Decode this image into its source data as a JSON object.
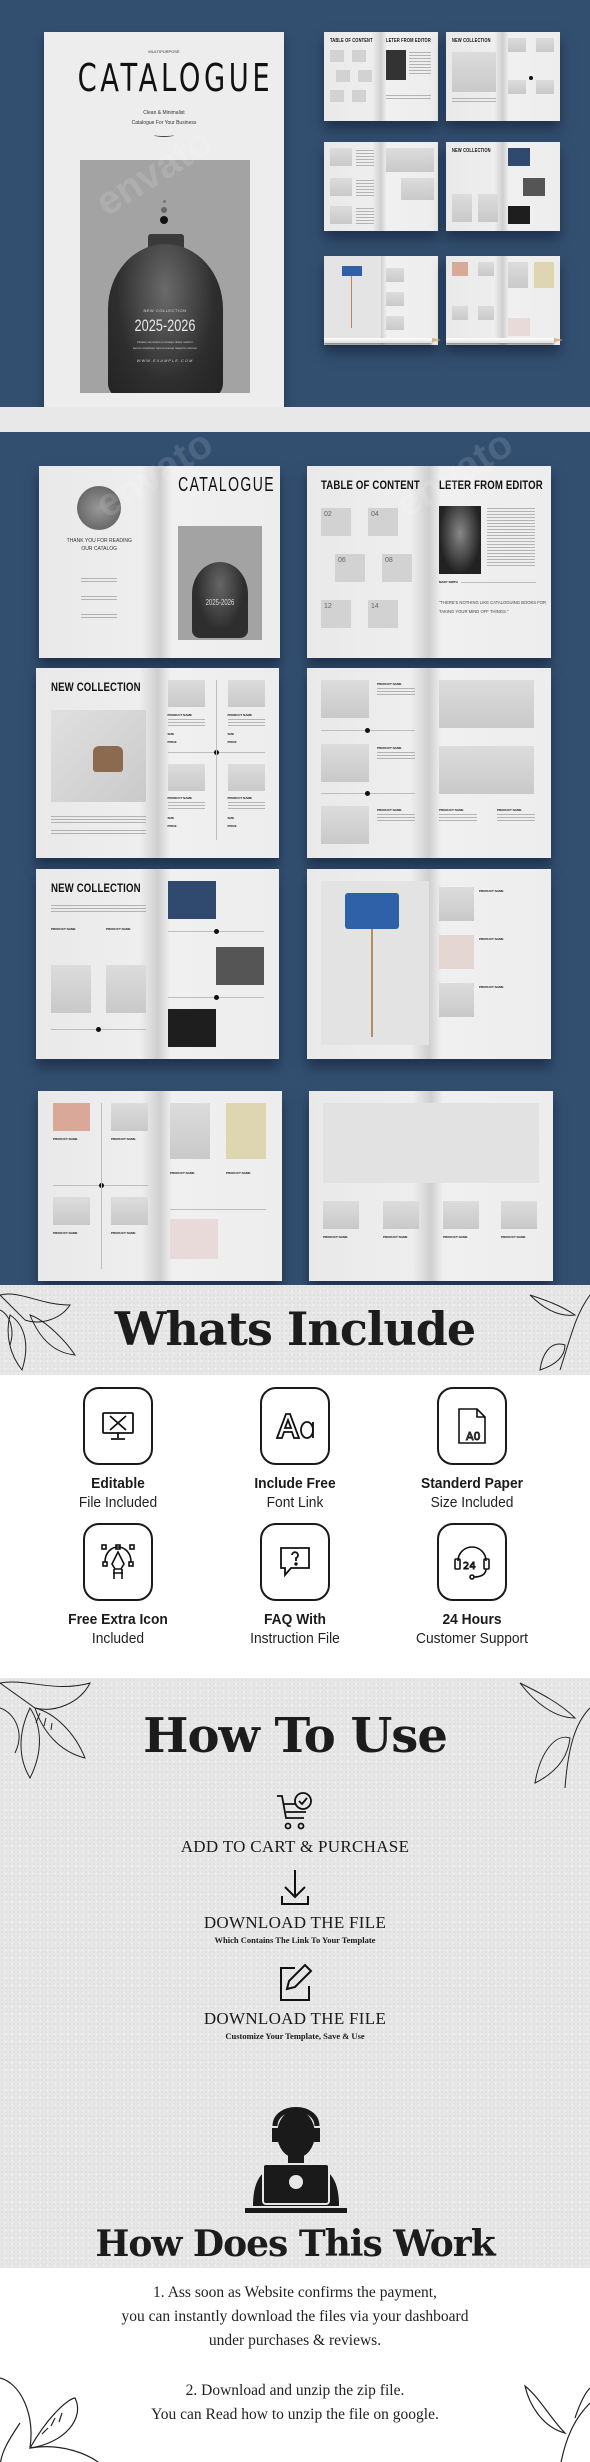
{
  "cover": {
    "eyebrow": "MULTIPURPOSE",
    "title": "CATALOGUE",
    "subtitle_line1": "Clean & Minimalist",
    "subtitle_line2": "Catalogue For Your Business",
    "badge": "NEW COLLECTION",
    "years": "2025-2026",
    "blurb_line1": "Ficatem as dolorem amaqui doles molorro",
    "blurb_line2": "berum voluptaes reped etuolup tasperia volorum",
    "website": "WWW.EXAMPLE.COM"
  },
  "thumb_spreads": [
    {
      "left_title": "TABLE OF CONTENT",
      "right_title": "LETER FROM EDITOR"
    },
    {
      "left_title": "NEW COLLECTION",
      "right_title": ""
    },
    {
      "left_title": "",
      "right_title": ""
    },
    {
      "left_title": "NEW COLLECTION",
      "right_title": ""
    },
    {
      "left_title": "",
      "right_title": ""
    },
    {
      "left_title": "",
      "right_title": ""
    }
  ],
  "spreads": {
    "back_cover": {
      "thanks_line1": "THANK YOU FOR READING",
      "thanks_line2": "OUR CATALOG",
      "title": "CATALOGUE",
      "years": "2025-2026"
    },
    "toc": {
      "title": "TABLE OF CONTENT",
      "entries": [
        "02",
        "04",
        "06",
        "08",
        "12",
        "14"
      ]
    },
    "editor": {
      "title": "LETER FROM EDITOR",
      "name": "MARY SMITH",
      "quote_line1": "\"THERE'S NOTHING LIKE CATALOGUING BOOKS FOR",
      "quote_line2": "TAKING YOUR MIND OFF THINGS.\""
    },
    "collection_title": "NEW COLLECTION",
    "product_label": "PRODUCT NAME",
    "size_label": "SIZE",
    "price_label": "PRICE"
  },
  "watermark": "envato",
  "whats_include": {
    "title": "Whats Include",
    "features": [
      {
        "icon": "monitor-design-icon",
        "title": "Editable",
        "subtitle": "File Included"
      },
      {
        "icon": "font-aa-icon",
        "title": "Include Free",
        "subtitle": "Font Link"
      },
      {
        "icon": "paper-a0-icon",
        "title": "Standerd Paper",
        "subtitle": "Size Included"
      },
      {
        "icon": "pen-tool-icon",
        "title": "Free Extra Icon",
        "subtitle": "Included"
      },
      {
        "icon": "faq-chat-icon",
        "title": "FAQ With",
        "subtitle": "Instruction File"
      },
      {
        "icon": "support-24-icon",
        "title": "24 Hours",
        "subtitle": "Customer Support"
      }
    ]
  },
  "how_to_use": {
    "title": "How To Use",
    "steps": [
      {
        "icon": "cart-check-icon",
        "title": "ADD TO CART & PURCHASE",
        "subtitle": ""
      },
      {
        "icon": "download-icon",
        "title": "DOWNLOAD THE FILE",
        "subtitle": "Which Contains The Link To Your Template"
      },
      {
        "icon": "edit-icon",
        "title": "DOWNLOAD THE FILE",
        "subtitle": "Customize Your Template, Save & Use"
      }
    ]
  },
  "how_it_works": {
    "title": "How Does This Work",
    "para1_line1": "1. Ass soon as Website confirms the payment,",
    "para1_line2": "you can instantly download the files via your dashboard",
    "para1_line3": "under purchases & reviews.",
    "para2_line1": "2. Download and unzip the zip file.",
    "para2_line2": "You can Read how to unzip the file on google."
  },
  "colors": {
    "navy": "#334f70",
    "paper": "#e7e7e7",
    "ink": "#1c1c1c"
  }
}
